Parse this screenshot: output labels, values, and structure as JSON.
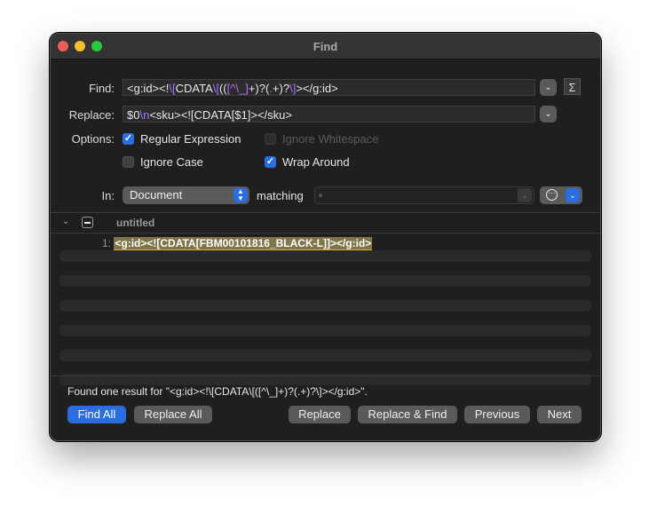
{
  "window": {
    "title": "Find"
  },
  "find": {
    "label": "Find:",
    "segments": [
      {
        "text": "<g:id><!",
        "regex": false
      },
      {
        "text": "\\[",
        "regex": true
      },
      {
        "text": "CDATA",
        "regex": false
      },
      {
        "text": "\\[",
        "regex": true
      },
      {
        "text": "((",
        "regex": false
      },
      {
        "text": "[^\\_]",
        "regex": true
      },
      {
        "text": "+)?(",
        "regex": false
      },
      {
        "text": ".",
        "regex": true
      },
      {
        "text": "+)?",
        "regex": false
      },
      {
        "text": "\\]",
        "regex": true
      },
      {
        "text": "></g:id>",
        "regex": false
      }
    ],
    "history_icon": "chevron-down",
    "sigma_label": "Σ"
  },
  "replace": {
    "label": "Replace:",
    "segments": [
      {
        "text": "$0",
        "regex": false
      },
      {
        "text": "\\n",
        "regex": true
      },
      {
        "text": "<sku><![CDATA[$1]></sku>",
        "regex": false
      }
    ],
    "history_icon": "chevron-down"
  },
  "options": {
    "label": "Options:",
    "regular_expression": {
      "label": "Regular Expression",
      "checked": true,
      "enabled": true
    },
    "ignore_whitespace": {
      "label": "Ignore Whitespace",
      "checked": false,
      "enabled": false
    },
    "ignore_case": {
      "label": "Ignore Case",
      "checked": false,
      "enabled": true
    },
    "wrap_around": {
      "label": "Wrap Around",
      "checked": true,
      "enabled": true
    }
  },
  "scope": {
    "label": "In:",
    "selected": "Document",
    "matching_label": "matching",
    "matching_value": ""
  },
  "results": {
    "document_name": "untitled",
    "items": [
      {
        "line": "1:",
        "match": "<g:id><![CDATA[FBM00101816_BLACK-L]]></g:id>"
      }
    ]
  },
  "status_text": "Found one result for \"<g:id><!\\[CDATA\\[([^\\_]+)?(.+)?\\]></g:id>\".",
  "buttons": {
    "find_all": "Find All",
    "replace_all": "Replace All",
    "replace": "Replace",
    "replace_and_find": "Replace & Find",
    "previous": "Previous",
    "next": "Next"
  },
  "colors": {
    "accent": "#2a6de0",
    "regex_highlight": "#b46eff",
    "match_highlight": "#7f7548",
    "match_underline": "#d9b800"
  }
}
